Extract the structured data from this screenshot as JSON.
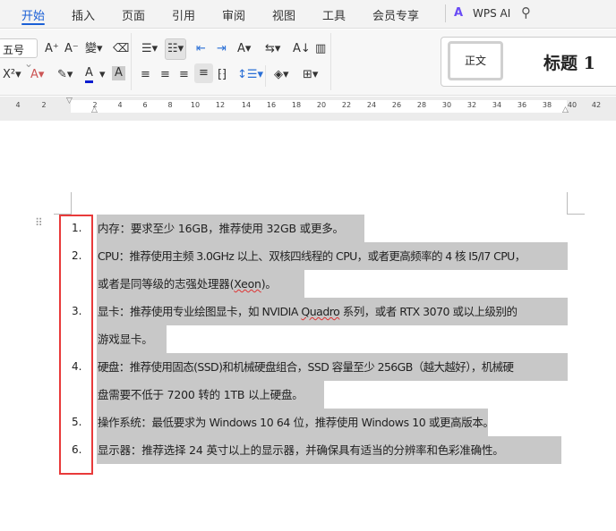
{
  "tabs": [
    {
      "label": "开始",
      "active": true
    },
    {
      "label": "插入"
    },
    {
      "label": "页面"
    },
    {
      "label": "引用"
    },
    {
      "label": "审阅"
    },
    {
      "label": "视图"
    },
    {
      "label": "工具"
    },
    {
      "label": "会员专享"
    }
  ],
  "wps_ai": "WPS AI",
  "ribbon": {
    "font_size": "五号",
    "styles": {
      "normal": "正文",
      "heading1": "标题 1"
    }
  },
  "ruler": [
    "4",
    "2",
    "2",
    "4",
    "6",
    "8",
    "10",
    "12",
    "14",
    "16",
    "18",
    "20",
    "22",
    "24",
    "26",
    "28",
    "30",
    "32",
    "34",
    "36",
    "38",
    "40",
    "42"
  ],
  "list": {
    "numbers": [
      "1.",
      "2.",
      "3.",
      "4.",
      "5.",
      "6."
    ],
    "lines": [
      "内存：要求至少 16GB，推荐使用 32GB 或更多。",
      "CPU：推荐使用主频 3.0GHz 以上、双核四线程的 CPU，或者更高频率的 4 核 I5/I7 CPU，",
      "或者是同等级的志强处理器(",
      "Xeon",
      ")。",
      "显卡：推荐使用专业绘图显卡，如 NVIDIA ",
      "Quadro",
      " 系列，或者 RTX 3070 或以上级别的",
      "游戏显卡。",
      "硬盘：推荐使用固态(SSD)和机械硬盘组合，SSD 容量至少 256GB（越大越好），机械硬",
      "盘需要不低于 7200 转的 1TB 以上硬盘。",
      "操作系统：最低要求为 Windows 10 64 位，推荐使用 Windows 10 或更高版本。",
      "显示器：推荐选择 24 英寸以上的显示器，并确保具有适当的分辨率和色彩准确性。"
    ]
  },
  "colors": {
    "accent": "#1a5fd6",
    "highlight": "#c8c8c8",
    "annotation": "#e83a3a"
  }
}
